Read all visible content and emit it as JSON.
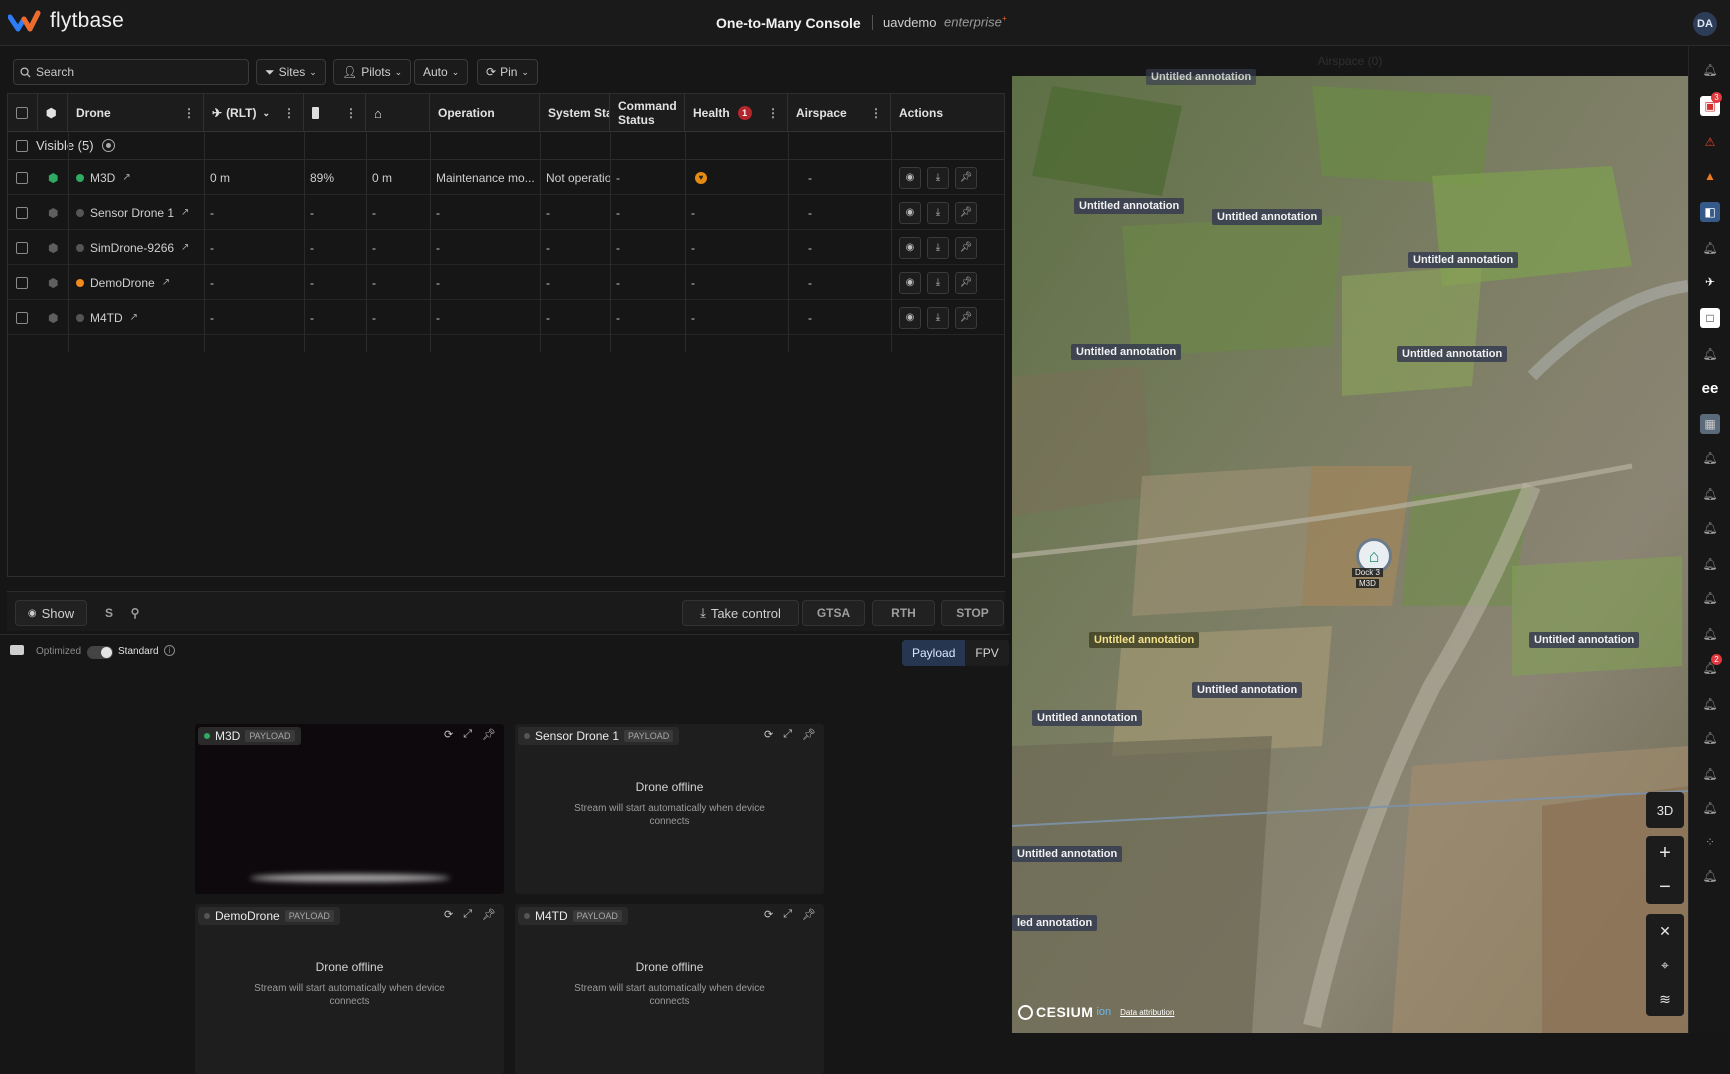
{
  "app": {
    "brand": "flytbase",
    "console_title": "One-to-Many Console",
    "org": "uavdemo",
    "plan": "enterprise",
    "plan_mark": "+",
    "avatar": "DA"
  },
  "filters": {
    "search_placeholder": "Search",
    "sites": "Sites",
    "pilots": "Pilots",
    "auto": "Auto",
    "pin": "Pin"
  },
  "table": {
    "headers": {
      "drone": "Drone",
      "rlt": "(RLT)",
      "operation": "Operation",
      "system_status": "System Stat",
      "command_status": "Command Status",
      "health": "Health",
      "health_count": "1",
      "airspace": "Airspace",
      "actions": "Actions"
    },
    "group": {
      "label": "Visible (5)"
    },
    "rows": [
      {
        "name": "M3D",
        "status_color": "#2faa62",
        "rlt": "0 m",
        "battery": "89%",
        "home": "0 m",
        "operation": "Maintenance mo...",
        "system": "Not operatio",
        "command": "-",
        "health": "warn",
        "airspace": "-"
      },
      {
        "name": "Sensor Drone 1",
        "status_color": "#555555",
        "rlt": "-",
        "battery": "-",
        "home": "-",
        "operation": "-",
        "system": "-",
        "command": "-",
        "health": "-",
        "airspace": "-"
      },
      {
        "name": "SimDrone-9266",
        "status_color": "#555555",
        "rlt": "-",
        "battery": "-",
        "home": "-",
        "operation": "-",
        "system": "-",
        "command": "-",
        "health": "-",
        "airspace": "-"
      },
      {
        "name": "DemoDrone",
        "status_color": "#f08a1c",
        "rlt": "-",
        "battery": "-",
        "home": "-",
        "operation": "-",
        "system": "-",
        "command": "-",
        "health": "-",
        "airspace": "-"
      },
      {
        "name": "M4TD",
        "status_color": "#555555",
        "rlt": "-",
        "battery": "-",
        "home": "-",
        "operation": "-",
        "system": "-",
        "command": "-",
        "health": "-",
        "airspace": "-"
      }
    ]
  },
  "control": {
    "show": "Show",
    "take_control": "Take control",
    "gtsa": "GTSA",
    "rth": "RTH",
    "stop": "STOP"
  },
  "feeds": {
    "optimized": "Optimized",
    "standard": "Standard",
    "payload_tab": "Payload",
    "fpv_tab": "FPV",
    "badge": "PAYLOAD",
    "offline_title": "Drone offline",
    "offline_sub": "Stream will start automatically when device connects",
    "tiles": [
      {
        "name": "M3D",
        "online": true
      },
      {
        "name": "Sensor Drone 1",
        "online": false
      },
      {
        "name": "DemoDrone",
        "online": false
      },
      {
        "name": "M4TD",
        "online": false
      }
    ]
  },
  "map": {
    "airspace_label": "Airspace (0)",
    "annotation": "Untitled annotation",
    "annotation_cut_top": "Untitled annotation",
    "annotation_cut_left": "led annotation",
    "dock_label_1": "Dock 3",
    "dock_label_2": "M3D",
    "mode_3d": "3D",
    "attribution": "Data attribution",
    "cesium": "CESIUM",
    "cesium_ion": "ion"
  },
  "rail": {
    "badge_top": "3",
    "badge_mid": "2"
  }
}
